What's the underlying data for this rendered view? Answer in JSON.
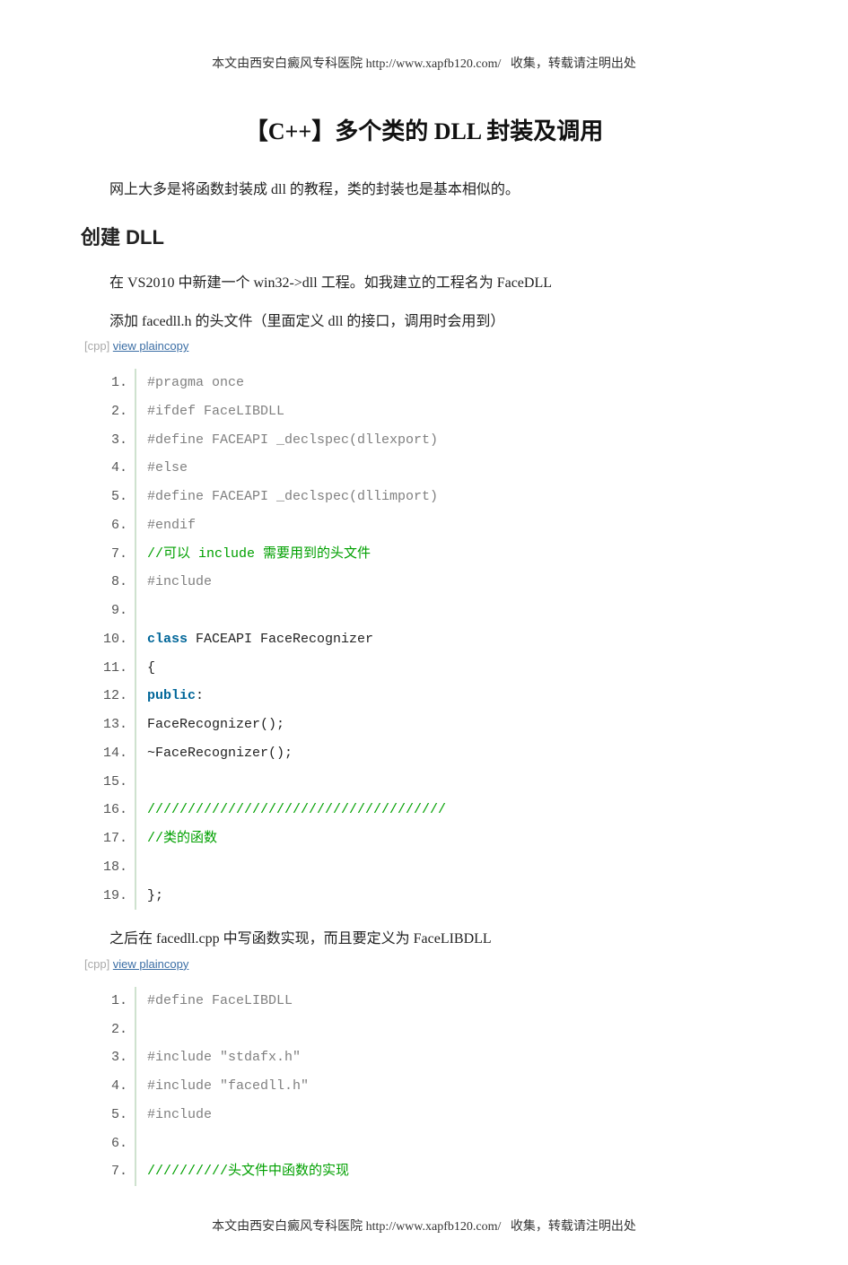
{
  "header": {
    "wm_prefix": "本文由西安白癜风专科医院",
    "wm_url": "http://www.xapfb120.com/",
    "wm_suffix": "收集，转载请注明出处"
  },
  "title": "【C++】多个类的 DLL 封装及调用",
  "intro_para": "网上大多是将函数封装成 dll 的教程，类的封装也是基本相似的。",
  "section_heading": "创建 DLL",
  "para_vs": "在 VS2010 中新建一个 win32->dll 工程。如我建立的工程名为 FaceDLL",
  "para_add_header": "添加 facedll.h 的头文件（里面定义 dll 的接口，调用时会用到）",
  "snippet_meta": {
    "lang": "[cpp] ",
    "view": "view plain",
    "copy": "copy"
  },
  "code1": [
    {
      "n": "1.",
      "seg": [
        {
          "cls": "tok-directive",
          "t": "#pragma once"
        }
      ]
    },
    {
      "n": "2.",
      "seg": [
        {
          "cls": "tok-directive",
          "t": "#ifdef FaceLIBDLL"
        }
      ]
    },
    {
      "n": "3.",
      "seg": [
        {
          "cls": "tok-directive",
          "t": "#define FACEAPI _declspec(dllexport)"
        }
      ]
    },
    {
      "n": "4.",
      "seg": [
        {
          "cls": "tok-directive",
          "t": "#else"
        }
      ]
    },
    {
      "n": "5.",
      "seg": [
        {
          "cls": "tok-directive",
          "t": "#define FACEAPI  _declspec(dllimport)"
        }
      ]
    },
    {
      "n": "6.",
      "seg": [
        {
          "cls": "tok-directive",
          "t": "#endif"
        }
      ]
    },
    {
      "n": "7.",
      "seg": [
        {
          "cls": "tok-comment",
          "t": "//可以 include 需要用到的头文件"
        }
      ]
    },
    {
      "n": "8.",
      "seg": [
        {
          "cls": "tok-directive",
          "t": "#include"
        }
      ]
    },
    {
      "n": "9.",
      "seg": []
    },
    {
      "n": "10.",
      "seg": [
        {
          "cls": "tok-keyword",
          "t": "class"
        },
        {
          "cls": "tok-plain",
          "t": " FACEAPI  FaceRecognizer"
        }
      ]
    },
    {
      "n": "11.",
      "seg": [
        {
          "cls": "tok-plain",
          "t": "{"
        }
      ]
    },
    {
      "n": "12.",
      "seg": [
        {
          "cls": "tok-keyword",
          "t": "public"
        },
        {
          "cls": "tok-plain",
          "t": ":"
        }
      ]
    },
    {
      "n": "13.",
      "seg": [
        {
          "cls": "tok-plain",
          "t": "    FaceRecognizer();"
        }
      ]
    },
    {
      "n": "14.",
      "seg": [
        {
          "cls": "tok-plain",
          "t": "    ~FaceRecognizer();"
        }
      ]
    },
    {
      "n": "15.",
      "seg": []
    },
    {
      "n": "16.",
      "seg": [
        {
          "cls": "tok-comment",
          "t": "/////////////////////////////////////"
        }
      ]
    },
    {
      "n": "17.",
      "seg": [
        {
          "cls": "tok-comment",
          "t": "//类的函数"
        }
      ]
    },
    {
      "n": "18.",
      "seg": []
    },
    {
      "n": "19.",
      "seg": [
        {
          "cls": "tok-plain",
          "t": "};"
        }
      ]
    }
  ],
  "para_cpp_impl": "之后在 facedll.cpp 中写函数实现，而且要定义为  FaceLIBDLL",
  "code2": [
    {
      "n": "1.",
      "seg": [
        {
          "cls": "tok-directive",
          "t": "#define FaceLIBDLL"
        }
      ]
    },
    {
      "n": "2.",
      "seg": []
    },
    {
      "n": "3.",
      "seg": [
        {
          "cls": "tok-directive",
          "t": "#include \"stdafx.h\""
        }
      ]
    },
    {
      "n": "4.",
      "seg": [
        {
          "cls": "tok-directive",
          "t": "#include \"facedll.h\""
        }
      ]
    },
    {
      "n": "5.",
      "seg": [
        {
          "cls": "tok-directive",
          "t": "#include"
        }
      ]
    },
    {
      "n": "6.",
      "seg": []
    },
    {
      "n": "7.",
      "seg": [
        {
          "cls": "tok-comment",
          "t": "//////////头文件中函数的实现"
        }
      ]
    }
  ],
  "footer": {
    "wm_prefix": "本文由西安白癜风专科医院",
    "wm_url": "http://www.xapfb120.com/",
    "wm_suffix": "收集，转载请注明出处"
  }
}
